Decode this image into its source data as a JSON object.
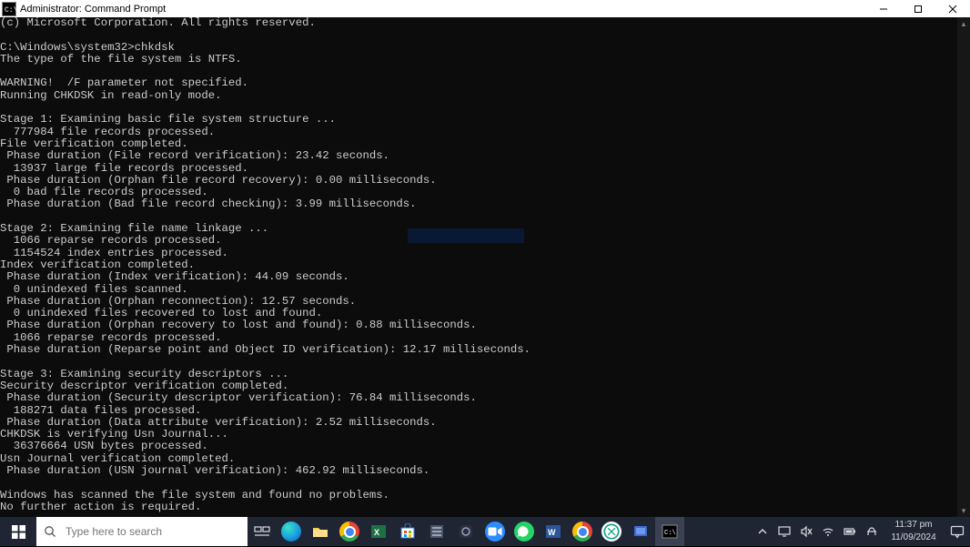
{
  "window": {
    "title": "Administrator: Command Prompt"
  },
  "console": {
    "lines": [
      "(c) Microsoft Corporation. All rights reserved.",
      "",
      "C:\\Windows\\system32>chkdsk",
      "The type of the file system is NTFS.",
      "",
      "WARNING!  /F parameter not specified.",
      "Running CHKDSK in read-only mode.",
      "",
      "Stage 1: Examining basic file system structure ...",
      "  777984 file records processed.",
      "File verification completed.",
      " Phase duration (File record verification): 23.42 seconds.",
      "  13937 large file records processed.",
      " Phase duration (Orphan file record recovery): 0.00 milliseconds.",
      "  0 bad file records processed.",
      " Phase duration (Bad file record checking): 3.99 milliseconds.",
      "",
      "Stage 2: Examining file name linkage ...",
      "  1066 reparse records processed.",
      "  1154524 index entries processed.",
      "Index verification completed.",
      " Phase duration (Index verification): 44.09 seconds.",
      "  0 unindexed files scanned.",
      " Phase duration (Orphan reconnection): 12.57 seconds.",
      "  0 unindexed files recovered to lost and found.",
      " Phase duration (Orphan recovery to lost and found): 0.88 milliseconds.",
      "  1066 reparse records processed.",
      " Phase duration (Reparse point and Object ID verification): 12.17 milliseconds.",
      "",
      "Stage 3: Examining security descriptors ...",
      "Security descriptor verification completed.",
      " Phase duration (Security descriptor verification): 76.84 milliseconds.",
      "  188271 data files processed.",
      " Phase duration (Data attribute verification): 2.52 milliseconds.",
      "CHKDSK is verifying Usn Journal...",
      "  36376664 USN bytes processed.",
      "Usn Journal verification completed.",
      " Phase duration (USN journal verification): 462.92 milliseconds.",
      "",
      "Windows has scanned the file system and found no problems.",
      "No further action is required."
    ]
  },
  "search": {
    "placeholder": "Type here to search"
  },
  "clock": {
    "time": "11:37 pm",
    "date": "11/09/2024"
  },
  "watermark": {
    "text": ""
  }
}
